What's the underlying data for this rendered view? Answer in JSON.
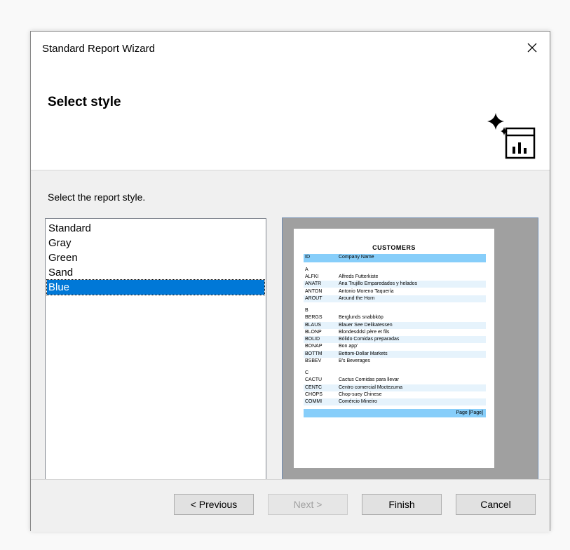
{
  "window": {
    "title": "Standard Report Wizard"
  },
  "header": {
    "heading": "Select style"
  },
  "body": {
    "instruction": "Select the report style."
  },
  "styles": {
    "items": [
      "Standard",
      "Gray",
      "Green",
      "Sand",
      "Blue"
    ],
    "selected": "Blue"
  },
  "preview": {
    "report_title": "CUSTOMERS",
    "col_id": "ID",
    "col_company": "Company Name",
    "groups": [
      {
        "letter": "A",
        "rows": [
          [
            "ALFKI",
            "Alfreds Futterkiste"
          ],
          [
            "ANATR",
            "Ana Trujillo Emparedados y helados"
          ],
          [
            "ANTON",
            "Antonio Moreno Taquería"
          ],
          [
            "AROUT",
            "Around the Horn"
          ]
        ]
      },
      {
        "letter": "B",
        "rows": [
          [
            "BERGS",
            "Berglunds snabbköp"
          ],
          [
            "BLAUS",
            "Blauer See Delikatessen"
          ],
          [
            "BLONP",
            "Blondesddsl père et fils"
          ],
          [
            "BOLID",
            "Bólido Comidas preparadas"
          ],
          [
            "BONAP",
            "Bon app'"
          ],
          [
            "BOTTM",
            "Bottom-Dollar Markets"
          ],
          [
            "BSBEV",
            "B's Beverages"
          ]
        ]
      },
      {
        "letter": "C",
        "rows": [
          [
            "CACTU",
            "Cactus Comidas para llevar"
          ],
          [
            "CENTC",
            "Centro comercial Moctezuma"
          ],
          [
            "CHOPS",
            "Chop-suey Chinese"
          ],
          [
            "COMMI",
            "Comércio Mineiro"
          ]
        ]
      }
    ],
    "footer": "Page [Page]"
  },
  "buttons": {
    "previous": "< Previous",
    "next": "Next >",
    "finish": "Finish",
    "cancel": "Cancel"
  },
  "colors": {
    "selection": "#0078d7",
    "band": "#87cefa",
    "alt_row": "#e6f3fc"
  }
}
